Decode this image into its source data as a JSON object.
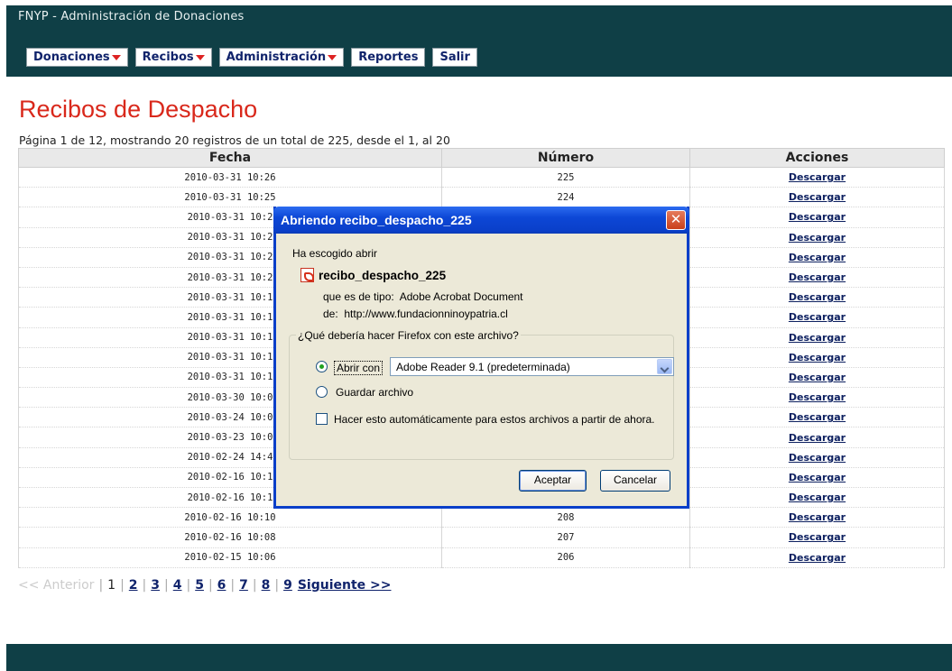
{
  "app": {
    "title": "FNYP - Administración de Donaciones"
  },
  "menu": [
    {
      "label": "Donaciones",
      "dropdown": true
    },
    {
      "label": "Recibos",
      "dropdown": true
    },
    {
      "label": "Administración",
      "dropdown": true
    },
    {
      "label": "Reportes",
      "dropdown": false
    },
    {
      "label": "Salir",
      "dropdown": false
    }
  ],
  "page": {
    "heading": "Recibos de Despacho",
    "info": "Página 1 de 12, mostrando 20 registros de un total de 225, desde el 1, al 20"
  },
  "table": {
    "columns": [
      "Fecha",
      "Número",
      "Acciones"
    ],
    "action_label": "Descargar",
    "rows": [
      {
        "fecha": "2010-03-31 10:26",
        "numero": "225"
      },
      {
        "fecha": "2010-03-31 10:25",
        "numero": "224"
      },
      {
        "fecha": "2010-03-31 10:2",
        "numero": ""
      },
      {
        "fecha": "2010-03-31 10:2",
        "numero": ""
      },
      {
        "fecha": "2010-03-31 10:2",
        "numero": ""
      },
      {
        "fecha": "2010-03-31 10:2",
        "numero": ""
      },
      {
        "fecha": "2010-03-31 10:1",
        "numero": ""
      },
      {
        "fecha": "2010-03-31 10:1",
        "numero": ""
      },
      {
        "fecha": "2010-03-31 10:1",
        "numero": ""
      },
      {
        "fecha": "2010-03-31 10:1",
        "numero": ""
      },
      {
        "fecha": "2010-03-31 10:1",
        "numero": ""
      },
      {
        "fecha": "2010-03-30 10:0",
        "numero": ""
      },
      {
        "fecha": "2010-03-24 10:0",
        "numero": ""
      },
      {
        "fecha": "2010-03-23 10:0",
        "numero": ""
      },
      {
        "fecha": "2010-02-24 14:4",
        "numero": ""
      },
      {
        "fecha": "2010-02-16 10:1",
        "numero": ""
      },
      {
        "fecha": "2010-02-16 10:1",
        "numero": ""
      },
      {
        "fecha": "2010-02-16 10:10",
        "numero": "208"
      },
      {
        "fecha": "2010-02-16 10:08",
        "numero": "207"
      },
      {
        "fecha": "2010-02-15 10:06",
        "numero": "206"
      }
    ]
  },
  "pager": {
    "prev": "<< Anterior",
    "current": "1",
    "pages": [
      "2",
      "3",
      "4",
      "5",
      "6",
      "7",
      "8",
      "9"
    ],
    "next": "Siguiente >>"
  },
  "dialog": {
    "title": "Abriendo recibo_despacho_225",
    "chosen": "Ha escogido abrir",
    "filename": "recibo_despacho_225",
    "type_label": "que es de tipo:",
    "type_value": "Adobe Acrobat Document",
    "from_label": "de:",
    "from_value": "http://www.fundacionninoypatria.cl",
    "question": "¿Qué debería hacer Firefox con este archivo?",
    "open_with_label": "Abrir con",
    "open_with_app": "Adobe Reader 9.1 (predeterminada)",
    "save_label": "Guardar archivo",
    "auto_label": "Hacer esto automáticamente para estos archivos a partir de ahora.",
    "ok_label": "Aceptar",
    "cancel_label": "Cancelar",
    "close_symbol": "✕"
  },
  "colors": {
    "header_bg": "#0f3f46",
    "heading_red": "#d9281b",
    "link_blue": "#10236b",
    "dialog_blue": "#0a3fc9"
  }
}
